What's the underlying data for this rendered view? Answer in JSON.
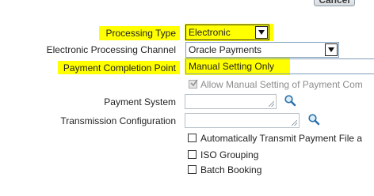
{
  "top": {
    "cancel_label": "Cancel"
  },
  "colors": {
    "highlight": "#ffff00",
    "field_border": "#7f9db9"
  },
  "form": {
    "processing_type": {
      "label": "Processing Type",
      "value": "Electronic"
    },
    "processing_channel": {
      "label": "Electronic Processing Channel",
      "value": "Oracle Payments"
    },
    "completion_point": {
      "label": "Payment Completion Point",
      "value": "Manual Setting Only"
    },
    "allow_manual": {
      "label": "Allow Manual Setting of Payment Com",
      "checked": true,
      "disabled": true
    },
    "payment_system": {
      "label": "Payment System",
      "value": ""
    },
    "transmission_config": {
      "label": "Transmission Configuration",
      "value": ""
    },
    "auto_transmit": {
      "label": "Automatically Transmit Payment File a",
      "checked": false
    },
    "iso_grouping": {
      "label": "ISO Grouping",
      "checked": false
    },
    "batch_booking": {
      "label": "Batch Booking",
      "checked": false
    }
  },
  "icons": {
    "search": "magnifier-icon",
    "dropdown": "chevron-down-icon",
    "resize": "resize-grip-icon"
  }
}
